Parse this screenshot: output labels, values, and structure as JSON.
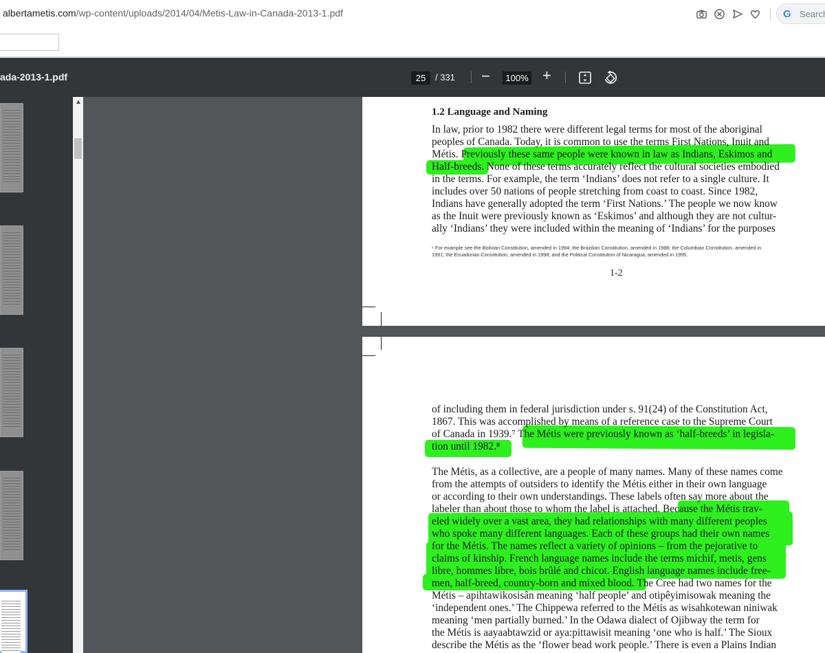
{
  "browser": {
    "url_host": "albertametis.com",
    "url_path": "/wp-content/uploads/2014/04/Metis-Law-in-Canada-2013-1.pdf",
    "search_placeholder": "Search",
    "icons": [
      "camera-icon",
      "blocked-icon",
      "send-icon",
      "heart-icon"
    ]
  },
  "pdf_toolbar": {
    "title": "ada-2013-1.pdf",
    "page_current": "25",
    "page_total": "/ 331",
    "zoom_minus": "−",
    "zoom_value": "100%",
    "zoom_plus": "+"
  },
  "page1": {
    "heading": "1.2 Language and Naming",
    "lines": [
      "In law, prior to 1982 there were different legal terms for most of the aboriginal",
      "peoples of Canada.  Today, it is common to use the terms First Nations, Inuit and",
      "Métis.  Previously these same people were known in law as Indians, Eskimos and",
      "Half-breeds.  None of these terms accurately reflect the cultural societies embodied",
      "in the terms.  For example, the term ‘Indians’ does not refer to a single culture.  It",
      "includes over 50 nations of people stretching from coast to coast.  Since 1982,",
      "Indians have generally adopted the term ‘First Nations.’  The people we now know",
      "as the Inuit were previously known as ‘Eskimos’ and although they are not cultur-",
      "ally ‘Indians’ they were included within the meaning of ‘Indians’ for the purposes"
    ],
    "footnote": [
      "⁶ For example see the Bolivian Constitution, amended in 1994; the Brazilian Constitution, amended in 1988; the Columbian Constitution, amended in",
      "1991; the Ecuadorian Constitution, amended in 1998; and the Political Constitution of Nicaragua, amended in 1995."
    ],
    "page_number": "1-2"
  },
  "page2": {
    "para1": [
      "of including them in federal jurisdiction under s. 91(24) of the Constitution Act,",
      "1867.  This was accomplished by means of a reference case to the Supreme Court",
      "of Canada in 1939.⁷  The Métis were previously known as ‘half-breeds’ in legisla-",
      "tion until 1982.⁸"
    ],
    "para2": [
      "The Métis, as a collective, are a people of many names.  Many of these names come",
      "from the attempts of outsiders to identify the Métis either in their own language",
      "or according to their own understandings.  These labels often say more about the",
      "labeler than about those to whom the label is attached.  Because the Métis trav-",
      "eled widely over a vast area, they had relationships with many different peoples",
      "who spoke many different languages.  Each of these groups had their own names",
      "for the Métis.  The names reflect a variety of opinions – from the pejorative to",
      "claims of kinship.  French language names include the terms michif, metis, gens",
      "libre, hommes libre, bois brûlé and chicot.  English language names include free-",
      "men, half-breed, country-born and mixed blood.  The Cree had two names for the",
      "Métis – apihtawikosisân meaning ‘half people’ and otipêyimisowak meaning the",
      "‘independent ones.’  The Chippewa referred to the Métis as wisahkotewan niniwak",
      "meaning ‘men partially burned.’  In the Odawa dialect of Ojibway the term for",
      "the Métis is aayaabtawzid or aya:pittawisit meaning ‘one who is half.’  The Sioux",
      "describe the Métis as the ‘flower bead work people.’  There is even a Plains Indian"
    ]
  },
  "colors": {
    "highlight": "#2df01e",
    "toolbar_bg": "#323639",
    "viewer_bg": "#525659"
  }
}
